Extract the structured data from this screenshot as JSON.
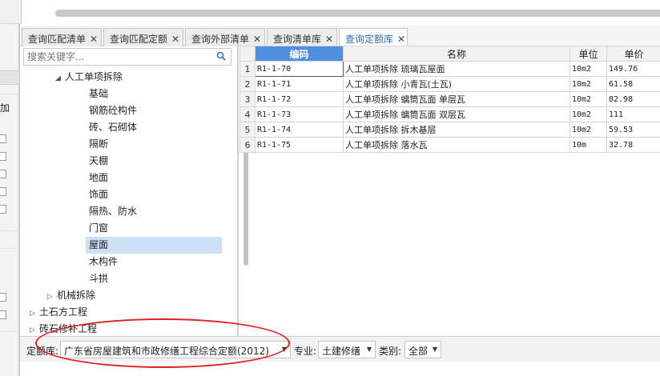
{
  "left_strip": {
    "label": "加"
  },
  "tabs": [
    {
      "label": "查询匹配清单",
      "active": false
    },
    {
      "label": "查询匹配定额",
      "active": false
    },
    {
      "label": "查询外部清单",
      "active": false
    },
    {
      "label": "查询清单库",
      "active": false
    },
    {
      "label": "查询定额库",
      "active": true
    }
  ],
  "tab_close_glyph": "✕",
  "search": {
    "placeholder": "搜索关键字...",
    "icon": "search-icon"
  },
  "tree": [
    {
      "label": "人工单项拆除",
      "level": 1,
      "expanded": true
    },
    {
      "label": "基础",
      "level": 2
    },
    {
      "label": "钢筋砼构件",
      "level": 2
    },
    {
      "label": "砖、石砌体",
      "level": 2
    },
    {
      "label": "隔断",
      "level": 2
    },
    {
      "label": "天棚",
      "level": 2
    },
    {
      "label": "地面",
      "level": 2
    },
    {
      "label": "饰面",
      "level": 2
    },
    {
      "label": "隔热、防水",
      "level": 2
    },
    {
      "label": "门窗",
      "level": 2
    },
    {
      "label": "屋面",
      "level": 2,
      "selected": true
    },
    {
      "label": "木构件",
      "level": 2
    },
    {
      "label": "斗拱",
      "level": 2
    },
    {
      "label": "机械拆除",
      "level": 1,
      "expanded": false
    },
    {
      "label": "土石方工程",
      "level": 0,
      "expanded": false
    },
    {
      "label": "砖石修补工程",
      "level": 0,
      "expanded": false
    }
  ],
  "grid": {
    "headers": {
      "code": "编码",
      "name": "名称",
      "unit": "单位",
      "price": "单价"
    },
    "rows": [
      {
        "no": "1",
        "code": "R1-1-70",
        "name": "人工单项拆除 琉璃瓦屋面",
        "unit": "10m2",
        "price": "149.76"
      },
      {
        "no": "2",
        "code": "R1-1-71",
        "name": "人工单项拆除 小青瓦(土瓦)",
        "unit": "10m2",
        "price": "61.58"
      },
      {
        "no": "3",
        "code": "R1-1-72",
        "name": "人工单项拆除 螭筒瓦面 单层瓦",
        "unit": "10m2",
        "price": "82.98"
      },
      {
        "no": "4",
        "code": "R1-1-73",
        "name": "人工单项拆除 螭筒瓦面 双层瓦",
        "unit": "10m2",
        "price": "111"
      },
      {
        "no": "5",
        "code": "R1-1-74",
        "name": "人工单项拆除 拆木基层",
        "unit": "10m2",
        "price": "59.53"
      },
      {
        "no": "6",
        "code": "R1-1-75",
        "name": "人工单项拆除 落水瓦",
        "unit": "10m",
        "price": "32.78"
      }
    ]
  },
  "bottom": {
    "quota_label": "定额库:",
    "quota_value": "广东省房屋建筑和市政修缮工程综合定额(2012)",
    "specialty_label": "专业:",
    "specialty_value": "土建修缮",
    "category_label": "类别:",
    "category_value": "全部"
  },
  "colors": {
    "accent": "#4f8fe0",
    "annotation": "#e02020",
    "selected": "#cde0f4"
  }
}
